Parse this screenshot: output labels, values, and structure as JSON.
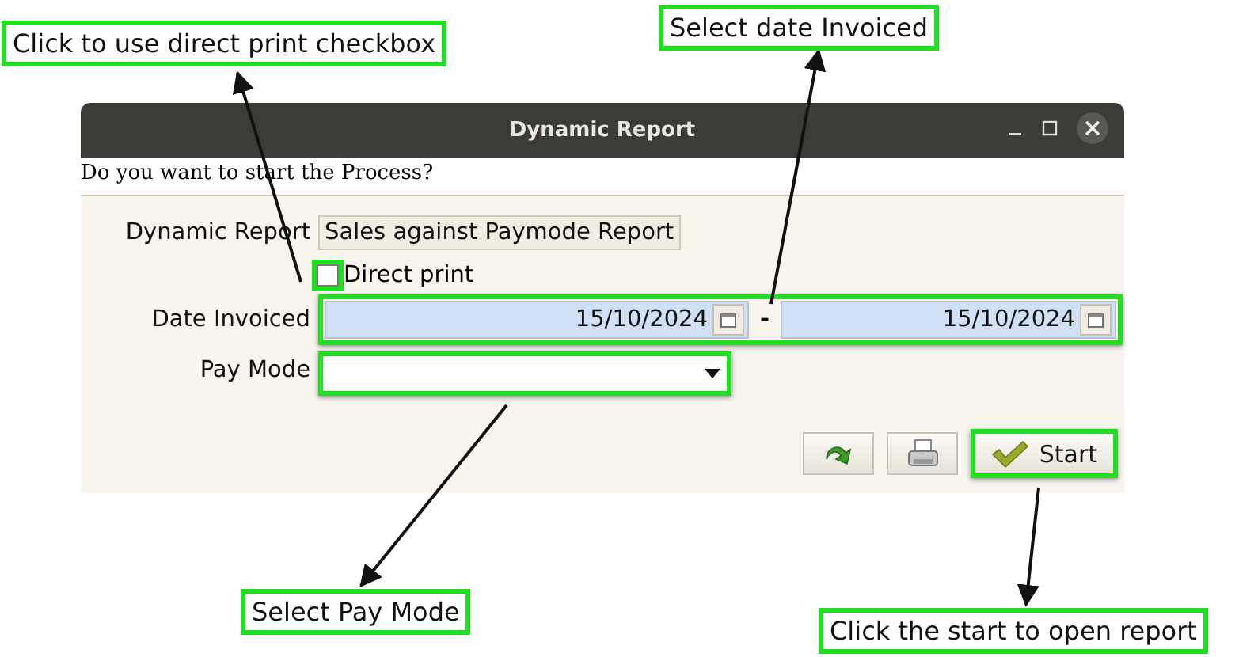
{
  "window": {
    "title": "Dynamic Report"
  },
  "prompt": "Do you want to start the Process?",
  "form": {
    "report": {
      "label": "Dynamic Report",
      "value": "Sales against Paymode Report"
    },
    "direct_print": {
      "label": "Direct print",
      "checked": false
    },
    "date_invoiced": {
      "label": "Date Invoiced",
      "from": "15/10/2024",
      "separator": "-",
      "to": "15/10/2024"
    },
    "pay_mode": {
      "label": "Pay Mode"
    }
  },
  "buttons": [
    {
      "kind": "refresh"
    },
    {
      "kind": "print"
    },
    {
      "kind": "start",
      "label": "Start"
    }
  ],
  "annotations": [
    {
      "text": "Click to use direct print checkbox"
    },
    {
      "text": "Select date Invoiced"
    },
    {
      "text": "Select Pay Mode"
    },
    {
      "text": "Click the start to open report"
    }
  ]
}
